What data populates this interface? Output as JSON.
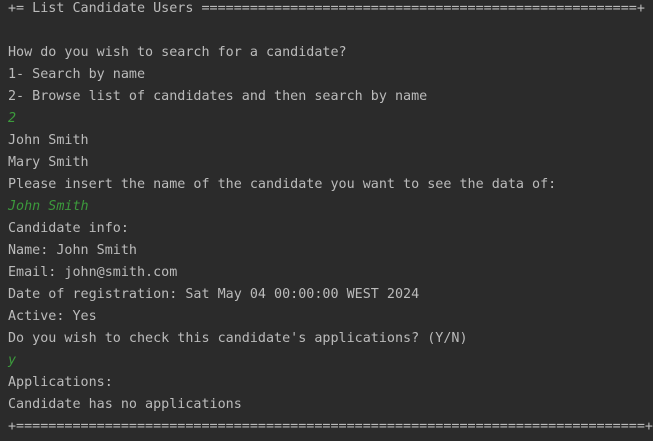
{
  "console": {
    "header": "+= List Candidate Users ======================================================+",
    "prompt_search": "How do you wish to search for a candidate?",
    "option_1": "1- Search by name",
    "option_2": "2- Browse list of candidates and then search by name",
    "input_choice": "2",
    "candidates": [
      "John Smith",
      "Mary Smith"
    ],
    "prompt_name": "Please insert the name of the candidate you want to see the data of:",
    "input_name": "John Smith",
    "info_title": "Candidate info:",
    "info_name": "Name: John Smith",
    "info_email": "Email: john@smith.com",
    "info_date": "Date of registration: Sat May 04 00:00:00 WEST 2024",
    "info_active": "Active: Yes",
    "prompt_applications": "Do you wish to check this candidate's applications? (Y/N)",
    "input_yn": "y",
    "applications_title": "Applications:",
    "applications_none": "Candidate has no applications",
    "footer": "+==============================================================================+"
  },
  "colors": {
    "background": "#2b2b2b",
    "text": "#bbbbbb",
    "user_input": "#3c9a3c"
  }
}
